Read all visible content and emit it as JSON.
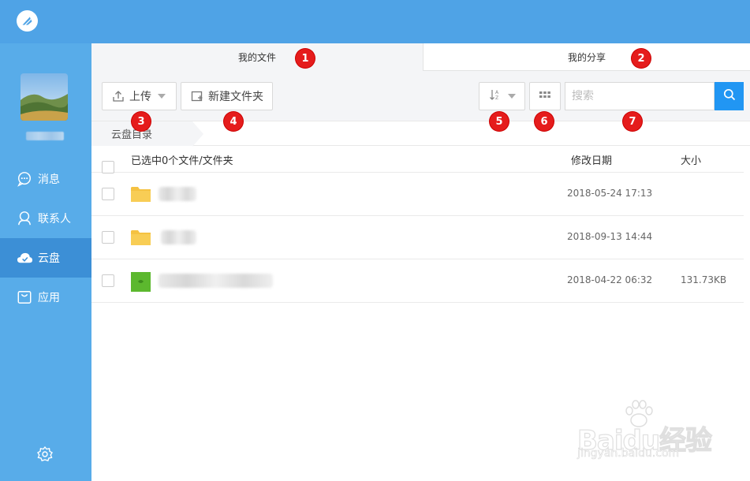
{
  "tabs": {
    "my_files": "我的文件",
    "my_share": "我的分享"
  },
  "sidebar": {
    "items": [
      {
        "label": "消息",
        "icon": "message-icon"
      },
      {
        "label": "联系人",
        "icon": "contacts-icon"
      },
      {
        "label": "云盘",
        "icon": "cloud-icon",
        "active": true
      },
      {
        "label": "应用",
        "icon": "apps-icon"
      }
    ]
  },
  "toolbar": {
    "upload_label": "上传",
    "new_folder_label": "新建文件夹",
    "search_placeholder": "搜索"
  },
  "breadcrumb": {
    "root": "云盘目录"
  },
  "file_list": {
    "header": {
      "selection": "已选中0个文件/文件夹",
      "modified": "修改日期",
      "size": "大小"
    },
    "rows": [
      {
        "type": "folder",
        "modified": "2018-05-24 17:13",
        "size": ""
      },
      {
        "type": "folder",
        "modified": "2018-09-13 14:44",
        "size": ""
      },
      {
        "type": "file",
        "modified": "2018-04-22 06:32",
        "size": "131.73KB"
      }
    ]
  },
  "badges": [
    "1",
    "2",
    "3",
    "4",
    "5",
    "6",
    "7"
  ],
  "watermark": {
    "brand": "Baidu经验",
    "url": "jingyan.baidu.com"
  },
  "colors": {
    "topbar": "#4fa3e6",
    "sidebar": "#58ace9",
    "sidebar_active": "#3c8fd6",
    "accent": "#2196f3",
    "badge": "#e51c1c"
  }
}
